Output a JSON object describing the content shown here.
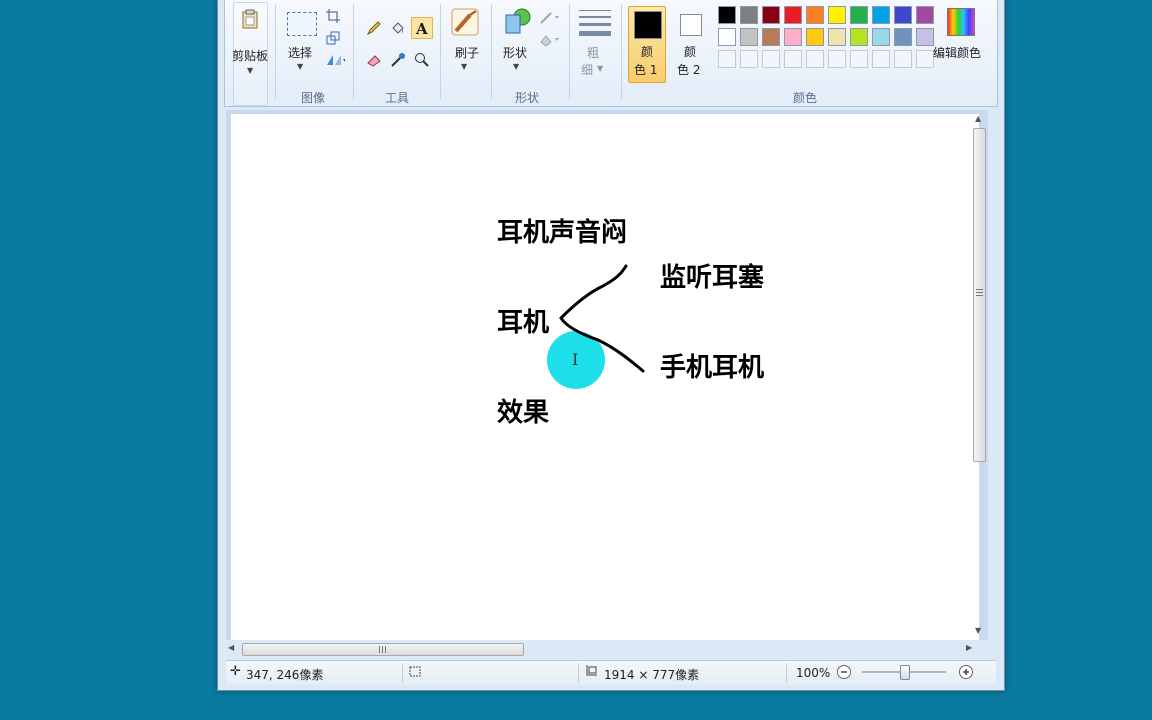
{
  "ribbon": {
    "clipboard": {
      "paste_label": "剪贴板"
    },
    "image": {
      "select_label": "选择",
      "group_label": "图像"
    },
    "tools": {
      "group_label": "工具"
    },
    "brushes": {
      "label": "刷子"
    },
    "shapes": {
      "label": "形状",
      "group_label": "形状"
    },
    "size": {
      "label_line1": "粗",
      "label_line2": "细"
    },
    "colors": {
      "color1_line1": "颜",
      "color1_line2": "色 1",
      "color2_line1": "颜",
      "color2_line2": "色 2",
      "edit_label": "编辑颜色",
      "group_label": "颜色",
      "color1_value": "#000000",
      "color2_value": "#ffffff",
      "palette_row1": [
        "#000000",
        "#7f7f7f",
        "#880015",
        "#ed1c24",
        "#ff7f27",
        "#fff200",
        "#22b14c",
        "#00a2e8",
        "#3f48cc",
        "#a349a4"
      ],
      "palette_row2": [
        "#ffffff",
        "#c3c3c3",
        "#b97a57",
        "#ffaec9",
        "#ffc90e",
        "#efe4b0",
        "#b5e61d",
        "#99d9ea",
        "#7092be",
        "#c8bfe7"
      ]
    }
  },
  "canvas": {
    "heading": "耳机声音闷",
    "root_node": "耳机",
    "branch_top": "监听耳塞",
    "branch_bottom": "手机耳机",
    "footer_node": "效果",
    "text_cursor": "I"
  },
  "status": {
    "cursor_position": "347, 246像素",
    "image_size": "1914 × 777像素",
    "zoom": "100%"
  }
}
